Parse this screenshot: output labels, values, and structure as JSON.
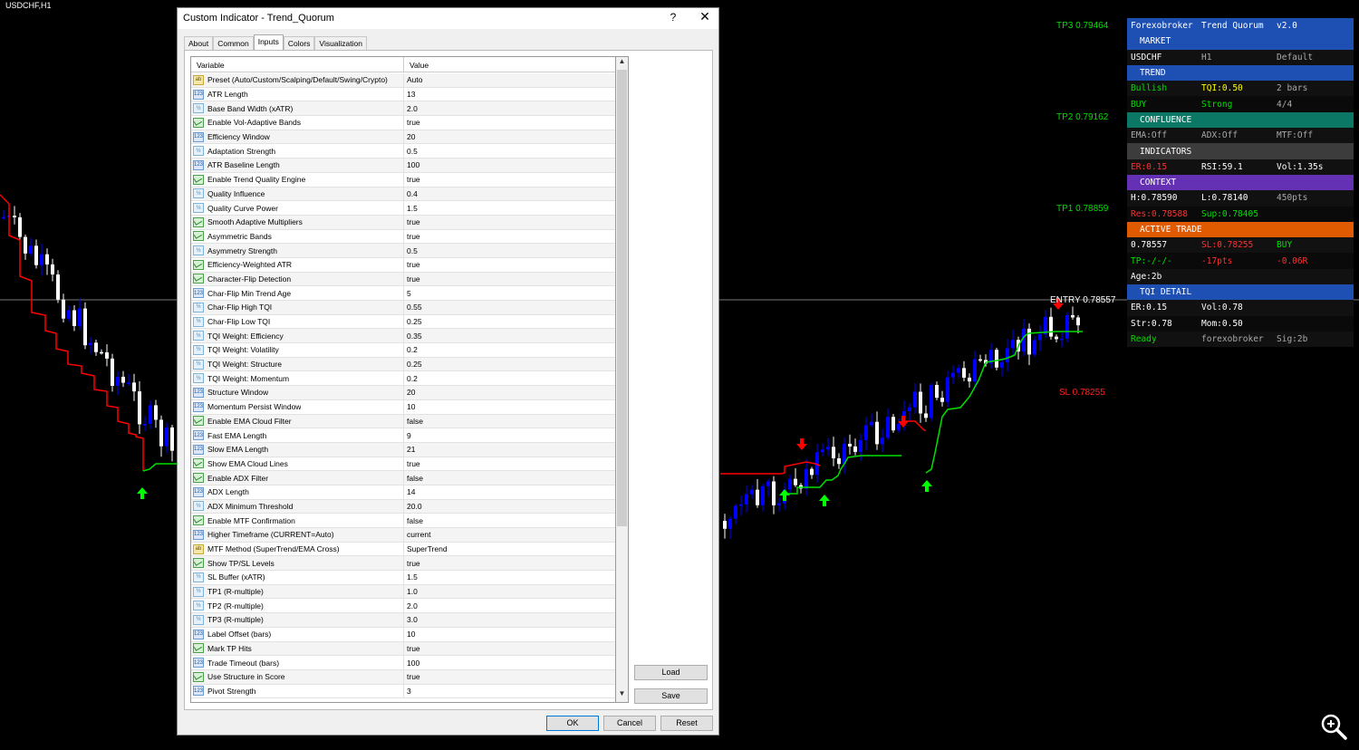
{
  "chart": {
    "symbol": "USDCHF,H1",
    "levels": {
      "tp3": "TP3 0.79464",
      "tp2": "TP2 0.79162",
      "tp1": "TP1 0.78859",
      "entry": "ENTRY 0.78557",
      "sl": "SL 0.78255"
    },
    "colors": {
      "bull": "#0000ff",
      "bear": "#ffffff",
      "trend_up": "#00e000",
      "trend_down": "#ff0000",
      "arrow_up": "#00ff00",
      "arrow_down": "#ff0000"
    }
  },
  "panel": {
    "title": {
      "c1": "Forexobroker",
      "c2": "Trend Quorum",
      "c3": "v2.0"
    },
    "sections": [
      {
        "header": "MARKET",
        "color": "#1e50b4",
        "rows": [
          [
            {
              "t": "USDCHF",
              "c": "#ffffff"
            },
            {
              "t": "H1",
              "c": "#aaaaaa"
            },
            {
              "t": "Default",
              "c": "#aaaaaa"
            }
          ]
        ]
      },
      {
        "header": "TREND",
        "color": "#1e50b4",
        "rows": [
          [
            {
              "t": "Bullish",
              "c": "#00e000"
            },
            {
              "t": "TQI:0.50",
              "c": "#ffff00"
            },
            {
              "t": "2 bars",
              "c": "#aaaaaa"
            }
          ],
          [
            {
              "t": "BUY",
              "c": "#00e000"
            },
            {
              "t": "Strong",
              "c": "#00e000"
            },
            {
              "t": "4/4",
              "c": "#aaaaaa"
            }
          ]
        ]
      },
      {
        "header": "CONFLUENCE",
        "color": "#0a7864",
        "rows": [
          [
            {
              "t": "EMA:Off",
              "c": "#aaaaaa"
            },
            {
              "t": "ADX:Off",
              "c": "#aaaaaa"
            },
            {
              "t": "MTF:Off",
              "c": "#aaaaaa"
            }
          ]
        ]
      },
      {
        "header": "INDICATORS",
        "color": "#3c3c3c",
        "rows": [
          [
            {
              "t": "ER:0.15",
              "c": "#ff3030"
            },
            {
              "t": "RSI:59.1",
              "c": "#ffffff"
            },
            {
              "t": "Vol:1.35s",
              "c": "#ffffff"
            }
          ]
        ]
      },
      {
        "header": "CONTEXT",
        "color": "#6430b4",
        "rows": [
          [
            {
              "t": "H:0.78590",
              "c": "#ffffff"
            },
            {
              "t": "L:0.78140",
              "c": "#ffffff"
            },
            {
              "t": "450pts",
              "c": "#aaaaaa"
            }
          ],
          [
            {
              "t": "Res:0.78588",
              "c": "#ff3030"
            },
            {
              "t": "Sup:0.78405",
              "c": "#00e000"
            },
            {
              "t": "",
              "c": "#aaaaaa"
            }
          ]
        ]
      },
      {
        "header": "ACTIVE TRADE",
        "color": "#e05a00",
        "rows": [
          [
            {
              "t": "0.78557",
              "c": "#ffffff"
            },
            {
              "t": "SL:0.78255",
              "c": "#ff3030"
            },
            {
              "t": "BUY",
              "c": "#00e000"
            }
          ],
          [
            {
              "t": "TP:-/-/-",
              "c": "#00e000"
            },
            {
              "t": "-17pts",
              "c": "#ff3030"
            },
            {
              "t": "-0.06R",
              "c": "#ff3030"
            }
          ],
          [
            {
              "t": "Age:2b",
              "c": "#ffffff"
            },
            {
              "t": "",
              "c": "#ffffff"
            },
            {
              "t": "",
              "c": "#ffffff"
            }
          ]
        ]
      },
      {
        "header": "TQI DETAIL",
        "color": "#1e50b4",
        "rows": [
          [
            {
              "t": "ER:0.15",
              "c": "#ffffff"
            },
            {
              "t": "Vol:0.78",
              "c": "#ffffff"
            },
            {
              "t": "",
              "c": "#ffffff"
            }
          ],
          [
            {
              "t": "Str:0.78",
              "c": "#ffffff"
            },
            {
              "t": "Mom:0.50",
              "c": "#ffffff"
            },
            {
              "t": "",
              "c": "#ffffff"
            }
          ],
          [
            {
              "t": "Ready",
              "c": "#00e000"
            },
            {
              "t": "forexobroker",
              "c": "#aaaaaa"
            },
            {
              "t": "Sig:2b",
              "c": "#aaaaaa"
            }
          ]
        ]
      }
    ]
  },
  "dialog": {
    "title": "Custom Indicator - Trend_Quorum",
    "help": "?",
    "close": "✕",
    "tabs": [
      "About",
      "Common",
      "Inputs",
      "Colors",
      "Visualization"
    ],
    "active_tab": "Inputs",
    "columns": {
      "variable": "Variable",
      "value": "Value"
    },
    "params": [
      {
        "type": "str",
        "name": "Preset (Auto/Custom/Scalping/Default/Swing/Crypto)",
        "value": "Auto"
      },
      {
        "type": "int",
        "name": "ATR Length",
        "value": "13"
      },
      {
        "type": "dbl",
        "name": "Base Band Width (xATR)",
        "value": "2.0"
      },
      {
        "type": "bool",
        "name": "Enable Vol-Adaptive Bands",
        "value": "true"
      },
      {
        "type": "int",
        "name": "Efficiency Window",
        "value": "20"
      },
      {
        "type": "dbl",
        "name": "Adaptation Strength",
        "value": "0.5"
      },
      {
        "type": "int",
        "name": "ATR Baseline Length",
        "value": "100"
      },
      {
        "type": "bool",
        "name": "Enable Trend Quality Engine",
        "value": "true"
      },
      {
        "type": "dbl",
        "name": "Quality Influence",
        "value": "0.4"
      },
      {
        "type": "dbl",
        "name": "Quality Curve Power",
        "value": "1.5"
      },
      {
        "type": "bool",
        "name": "Smooth Adaptive Multipliers",
        "value": "true"
      },
      {
        "type": "bool",
        "name": "Asymmetric Bands",
        "value": "true"
      },
      {
        "type": "dbl",
        "name": "Asymmetry Strength",
        "value": "0.5"
      },
      {
        "type": "bool",
        "name": "Efficiency-Weighted ATR",
        "value": "true"
      },
      {
        "type": "bool",
        "name": "Character-Flip Detection",
        "value": "true"
      },
      {
        "type": "int",
        "name": "Char-Flip Min Trend Age",
        "value": "5"
      },
      {
        "type": "dbl",
        "name": "Char-Flip High TQI",
        "value": "0.55"
      },
      {
        "type": "dbl",
        "name": "Char-Flip Low TQI",
        "value": "0.25"
      },
      {
        "type": "dbl",
        "name": "TQI Weight: Efficiency",
        "value": "0.35"
      },
      {
        "type": "dbl",
        "name": "TQI Weight: Volatility",
        "value": "0.2"
      },
      {
        "type": "dbl",
        "name": "TQI Weight: Structure",
        "value": "0.25"
      },
      {
        "type": "dbl",
        "name": "TQI Weight: Momentum",
        "value": "0.2"
      },
      {
        "type": "int",
        "name": "Structure Window",
        "value": "20"
      },
      {
        "type": "int",
        "name": "Momentum Persist Window",
        "value": "10"
      },
      {
        "type": "bool",
        "name": "Enable EMA Cloud Filter",
        "value": "false"
      },
      {
        "type": "int",
        "name": "Fast EMA Length",
        "value": "9"
      },
      {
        "type": "int",
        "name": "Slow EMA Length",
        "value": "21"
      },
      {
        "type": "bool",
        "name": "Show EMA Cloud Lines",
        "value": "true"
      },
      {
        "type": "bool",
        "name": "Enable ADX Filter",
        "value": "false"
      },
      {
        "type": "int",
        "name": "ADX Length",
        "value": "14"
      },
      {
        "type": "dbl",
        "name": "ADX Minimum Threshold",
        "value": "20.0"
      },
      {
        "type": "bool",
        "name": "Enable MTF Confirmation",
        "value": "false"
      },
      {
        "type": "int",
        "name": "Higher Timeframe (CURRENT=Auto)",
        "value": "current"
      },
      {
        "type": "str",
        "name": "MTF Method (SuperTrend/EMA Cross)",
        "value": "SuperTrend"
      },
      {
        "type": "bool",
        "name": "Show TP/SL Levels",
        "value": "true"
      },
      {
        "type": "dbl",
        "name": "SL Buffer (xATR)",
        "value": "1.5"
      },
      {
        "type": "dbl",
        "name": "TP1 (R-multiple)",
        "value": "1.0"
      },
      {
        "type": "dbl",
        "name": "TP2 (R-multiple)",
        "value": "2.0"
      },
      {
        "type": "dbl",
        "name": "TP3 (R-multiple)",
        "value": "3.0"
      },
      {
        "type": "int",
        "name": "Label Offset (bars)",
        "value": "10"
      },
      {
        "type": "bool",
        "name": "Mark TP Hits",
        "value": "true"
      },
      {
        "type": "int",
        "name": "Trade Timeout (bars)",
        "value": "100"
      },
      {
        "type": "bool",
        "name": "Use Structure in Score",
        "value": "true"
      },
      {
        "type": "int",
        "name": "Pivot Strength",
        "value": "3"
      }
    ],
    "buttons": {
      "load": "Load",
      "save": "Save",
      "ok": "OK",
      "cancel": "Cancel",
      "reset": "Reset"
    }
  }
}
